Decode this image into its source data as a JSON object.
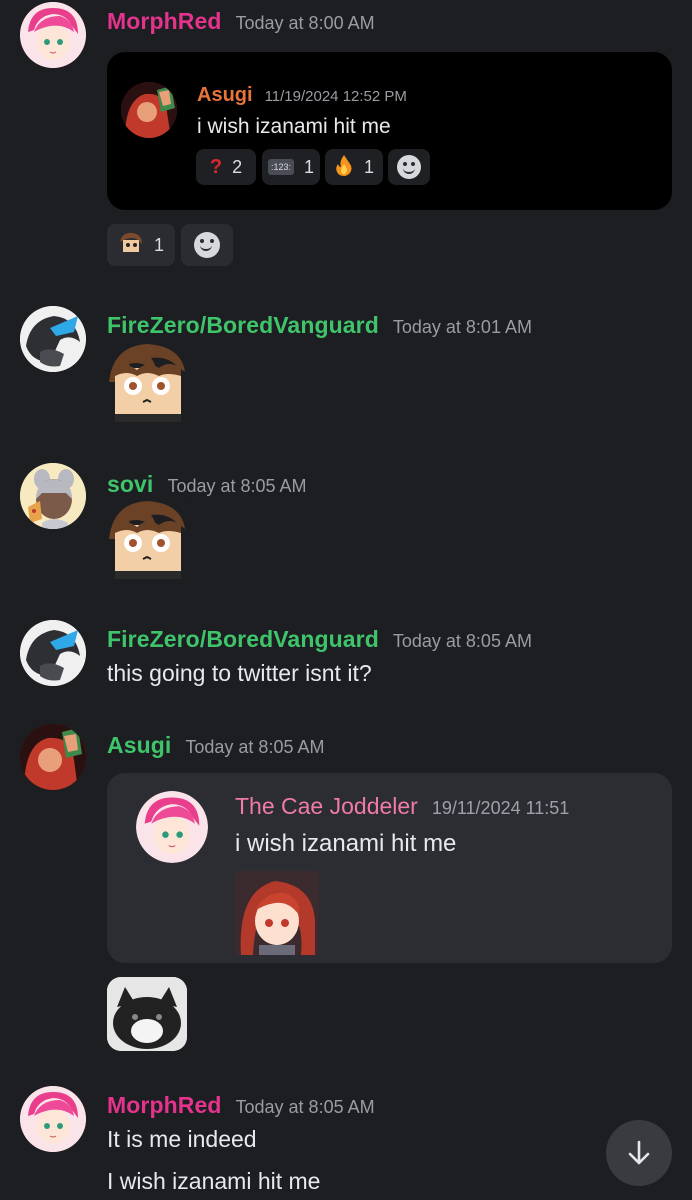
{
  "messages": [
    {
      "author": "MorphRed",
      "author_color": "#e4338d",
      "timestamp": "Today at 8:00 AM",
      "forward": {
        "author": "Asugi",
        "author_color": "#e8743b",
        "timestamp": "11/19/2024 12:52 PM",
        "text": "i wish izanami hit me",
        "reactions": [
          {
            "icon": "question-mark-icon",
            "glyph": "❓",
            "count": "2"
          },
          {
            "icon": "numbers-icon",
            "glyph": "1234",
            "count": "1"
          },
          {
            "icon": "fire-icon",
            "glyph": "🔥",
            "count": "1"
          }
        ]
      },
      "reactions": [
        {
          "icon": "custom-emoji-face-icon",
          "count": "1"
        }
      ]
    },
    {
      "author": "FireZero/BoredVanguard",
      "author_color": "#3fc46b",
      "timestamp": "Today at 8:01 AM"
    },
    {
      "author": "sovi",
      "author_color": "#3fc46b",
      "timestamp": "Today at 8:05 AM"
    },
    {
      "author": "FireZero/BoredVanguard",
      "author_color": "#3fc46b",
      "timestamp": "Today at 8:05 AM",
      "text": "this going to twitter isnt it?"
    },
    {
      "author": "Asugi",
      "author_color": "#3fc46b",
      "timestamp": "Today at 8:05 AM",
      "forward": {
        "author": "The Cae Joddeler",
        "author_color": "#f07aa8",
        "timestamp": "19/11/2024 11:51",
        "text": "i wish izanami hit me"
      }
    },
    {
      "author": "MorphRed",
      "author_color": "#e4338d",
      "timestamp": "Today at 8:05 AM",
      "lines": [
        "It is me indeed",
        "I wish izanami hit me"
      ]
    }
  ],
  "colors": {
    "background": "#1d1e22",
    "card_dark": "#000000",
    "card_light": "#2c2d32",
    "accent_green": "#3fc46b",
    "accent_pink": "#e4338d"
  }
}
